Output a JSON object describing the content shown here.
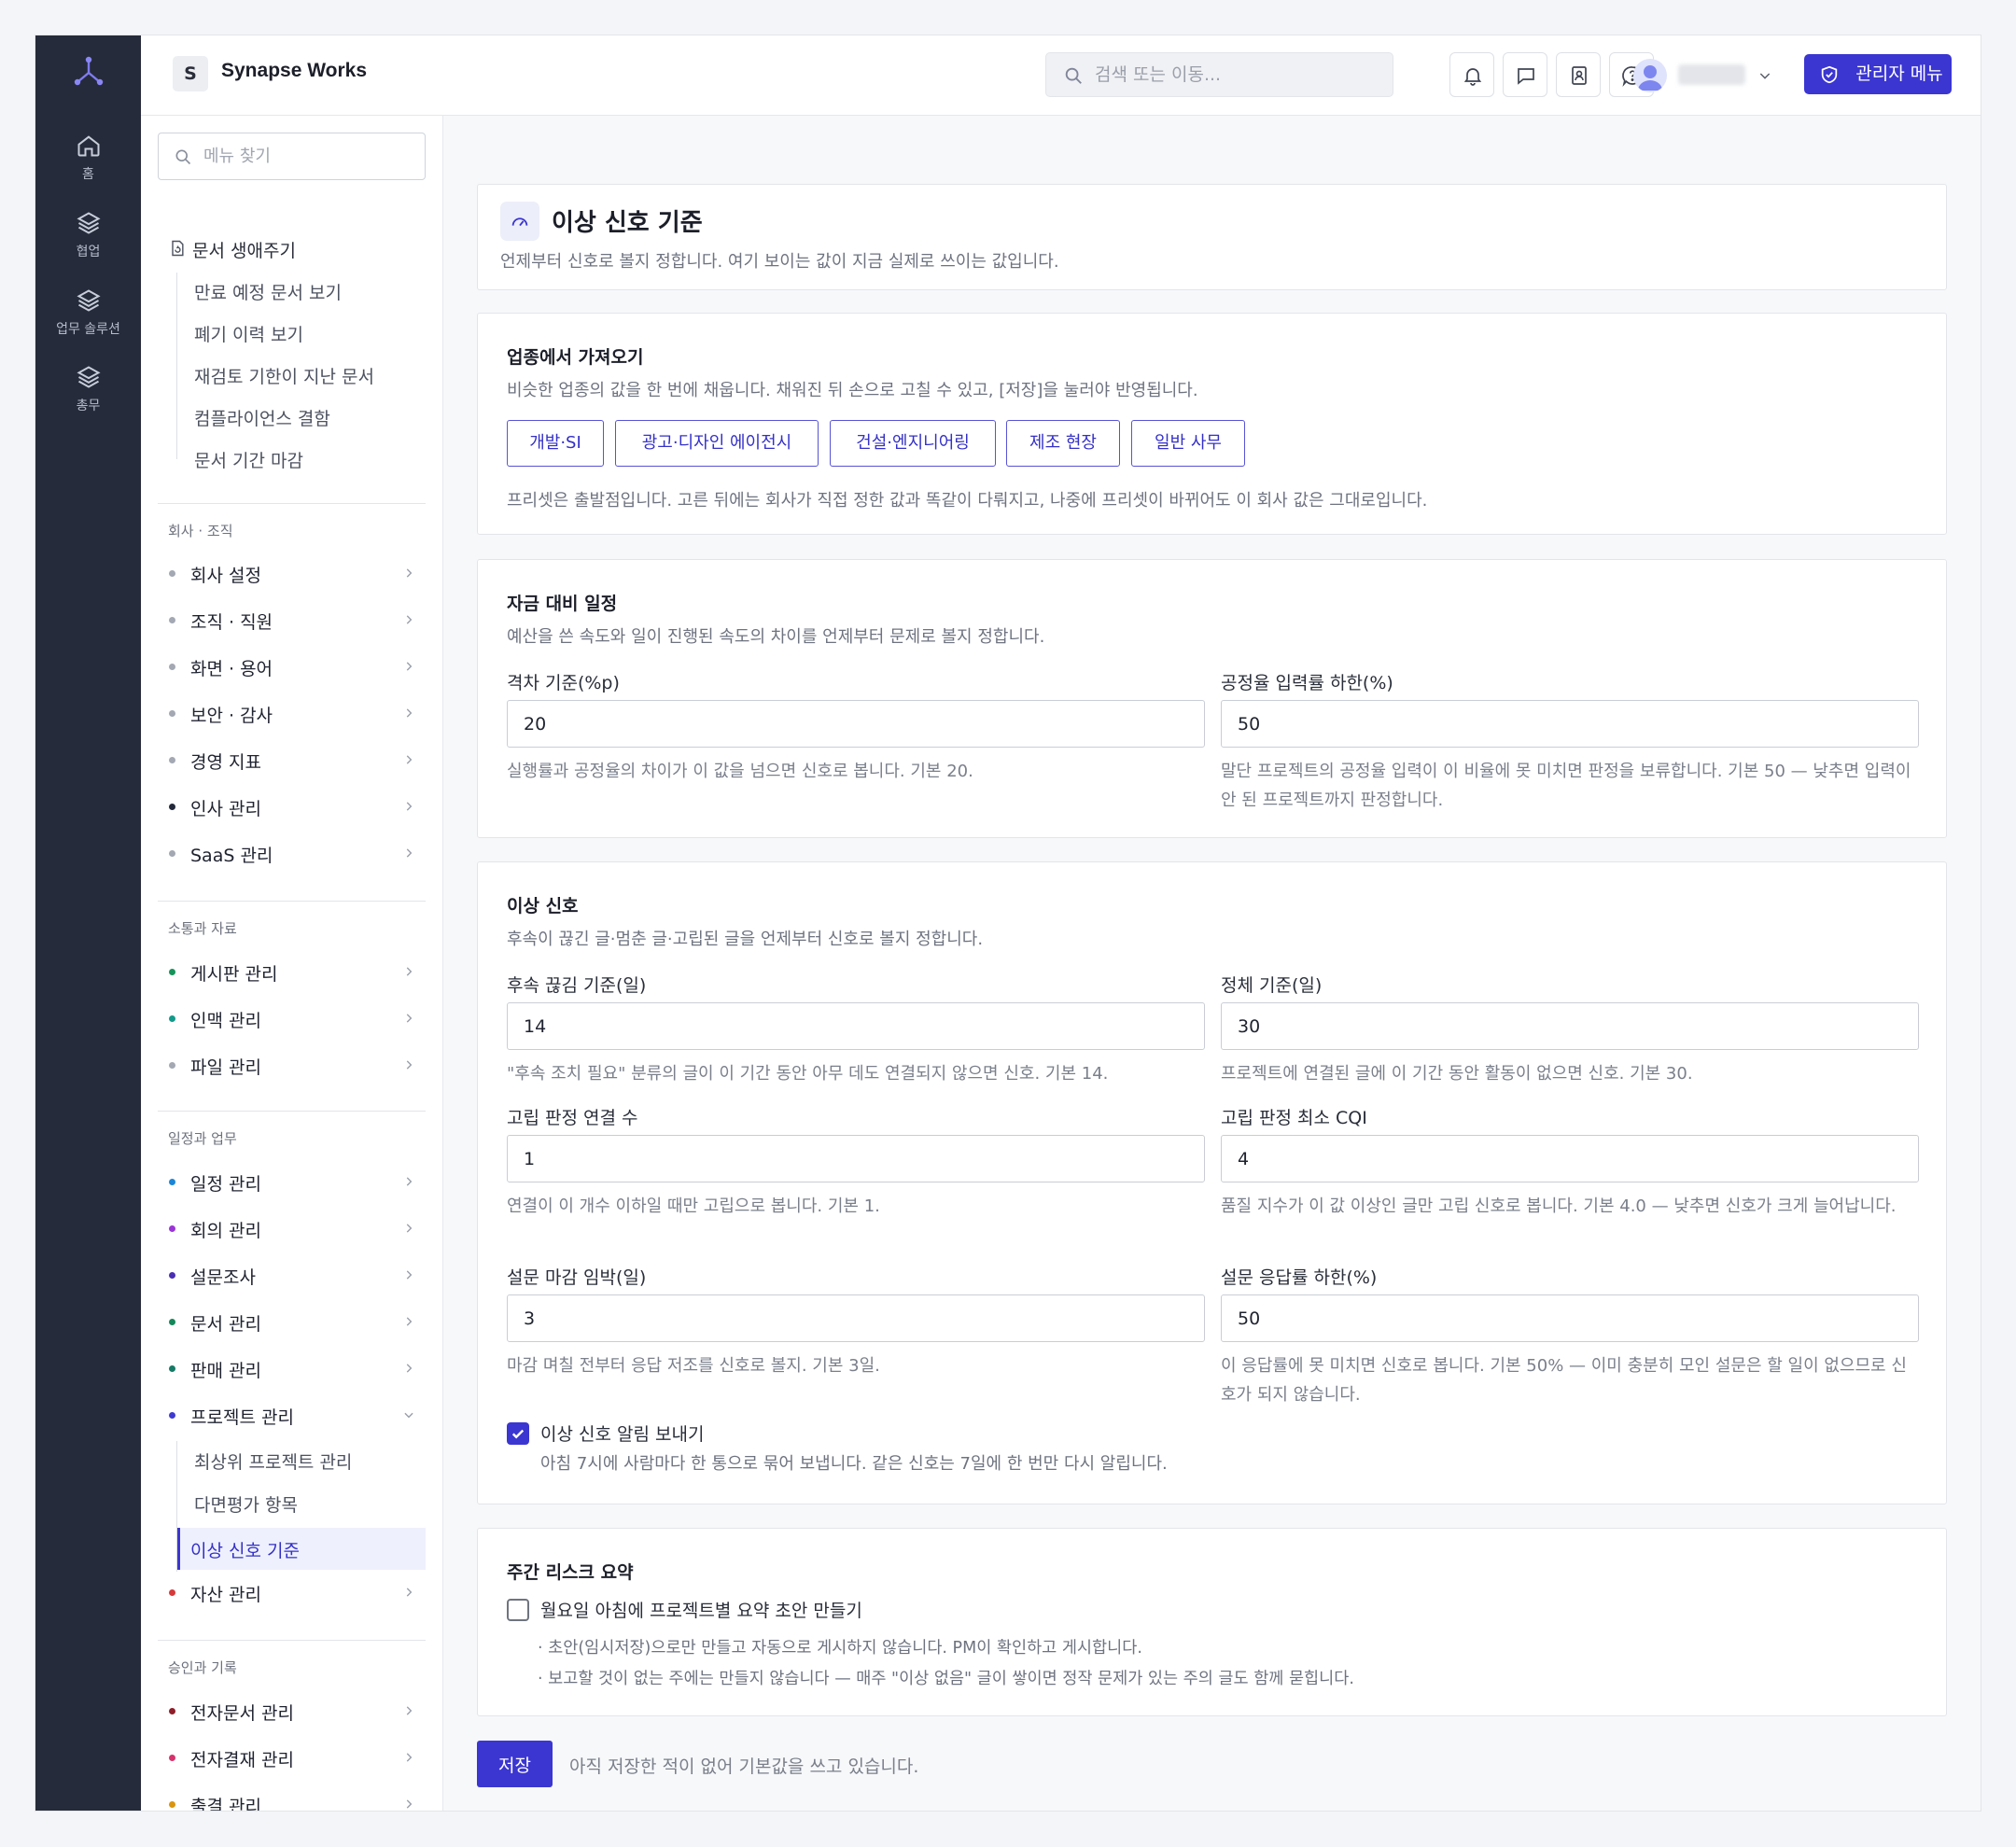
{
  "brand": {
    "accent": "#3b36d1",
    "rail_bg": "#262b3b"
  },
  "rail": {
    "items": [
      {
        "label": "홈",
        "icon": "home-icon"
      },
      {
        "label": "협업",
        "icon": "layers-icon"
      },
      {
        "label": "업무 솔루션",
        "icon": "layers-icon"
      },
      {
        "label": "총무",
        "icon": "layers-icon"
      }
    ]
  },
  "topbar": {
    "workspace_initial": "S",
    "workspace_name": "Synapse Works",
    "search_placeholder": "검색 또는 이동...",
    "icons": [
      "bell-icon",
      "chat-icon",
      "contacts-icon",
      "help-icon"
    ],
    "admin_label": "관리자 메뉴"
  },
  "menu": {
    "search_placeholder": "메뉴 찾기",
    "lifecycle": {
      "label": "문서 생애주기",
      "items": [
        "만료 예정 문서 보기",
        "폐기 이력 보기",
        "재검토 기한이 지난 문서",
        "컴플라이언스 결함",
        "문서 기간 마감"
      ]
    },
    "sections": [
      {
        "title": "회사 · 조직",
        "items": [
          "회사 설정",
          "조직 · 직원",
          "화면 · 용어",
          "보안 · 감사",
          "경영 지표",
          "인사 관리",
          "SaaS 관리"
        ]
      },
      {
        "title": "소통과 자료",
        "items": [
          "게시판 관리",
          "인맥 관리",
          "파일 관리"
        ]
      },
      {
        "title": "일정과 업무",
        "items": [
          "일정 관리",
          "회의 관리",
          "설문조사",
          "문서 관리",
          "판매 관리",
          "프로젝트 관리"
        ]
      },
      {
        "title": "승인과 기록",
        "items": [
          "전자문서 관리",
          "전자결재 관리",
          "출결 관리"
        ]
      }
    ],
    "project_sub": [
      "최상위 프로젝트 관리",
      "다면평가 항목",
      "이상 신호 기준"
    ],
    "asset": "자산 관리"
  },
  "page": {
    "title": "이상 신호 기준",
    "description": "언제부터 신호로 볼지 정합니다. 여기 보이는 값이 지금 실제로 쓰이는 값입니다."
  },
  "preset_card": {
    "title": "업종에서 가져오기",
    "description": "비슷한 업종의 값을 한 번에 채웁니다. 채워진 뒤 손으로 고칠 수 있고, [저장]을 눌러야 반영됩니다.",
    "buttons": [
      "개발·SI",
      "광고·디자인 에이전시",
      "건설·엔지니어링",
      "제조 현장",
      "일반 사무"
    ],
    "note": "프리셋은 출발점입니다. 고른 뒤에는 회사가 직접 정한 값과 똑같이 다뤄지고, 나중에 프리셋이 바뀌어도 이 회사 값은 그대로입니다."
  },
  "budget_card": {
    "title": "자금 대비 일정",
    "description": "예산을 쓴 속도와 일이 진행된 속도의 차이를 언제부터 문제로 볼지 정합니다.",
    "fields": [
      {
        "label": "격차 기준(%p)",
        "value": "20",
        "hint": "실행률과 공정율의 차이가 이 값을 넘으면 신호로 봅니다. 기본 20."
      },
      {
        "label": "공정율 입력률 하한(%)",
        "value": "50",
        "hint": "말단 프로젝트의 공정율 입력이 이 비율에 못 미치면 판정을 보류합니다. 기본 50 — 낮추면 입력이 안 된 프로젝트까지 판정합니다."
      }
    ]
  },
  "anomaly_card": {
    "title": "이상 신호",
    "description": "후속이 끊긴 글·멈춘 글·고립된 글을 언제부터 신호로 볼지 정합니다.",
    "fields": [
      {
        "label": "후속 끊김 기준(일)",
        "value": "14",
        "hint": "\"후속 조치 필요\" 분류의 글이 이 기간 동안 아무 데도 연결되지 않으면 신호. 기본 14."
      },
      {
        "label": "정체 기준(일)",
        "value": "30",
        "hint": "프로젝트에 연결된 글에 이 기간 동안 활동이 없으면 신호. 기본 30."
      },
      {
        "label": "고립 판정 연결 수",
        "value": "1",
        "hint": "연결이 이 개수 이하일 때만 고립으로 봅니다. 기본 1."
      },
      {
        "label": "고립 판정 최소 CQI",
        "value": "4",
        "hint": "품질 지수가 이 값 이상인 글만 고립 신호로 봅니다. 기본 4.0 — 낮추면 신호가 크게 늘어납니다."
      },
      {
        "label": "설문 마감 임박(일)",
        "value": "3",
        "hint": "마감 며칠 전부터 응답 저조를 신호로 볼지. 기본 3일."
      },
      {
        "label": "설문 응답률 하한(%)",
        "value": "50",
        "hint": "이 응답률에 못 미치면 신호로 봅니다. 기본 50% — 이미 충분히 모인 설문은 할 일이 없으므로 신호가 되지 않습니다."
      }
    ],
    "notify_label": "이상 신호 알림 보내기",
    "notify_checked": true,
    "notify_hint": "아침 7시에 사람마다 한 통으로 묶어 보냅니다. 같은 신호는 7일에 한 번만 다시 알립니다."
  },
  "weekly_card": {
    "title": "주간 리스크 요약",
    "checkbox_label": "월요일 아침에 프로젝트별 요약 초안 만들기",
    "checked": false,
    "notes": [
      "· 초안(임시저장)으로만 만들고 자동으로 게시하지 않습니다. PM이 확인하고 게시합니다.",
      "· 보고할 것이 없는 주에는 만들지 않습니다 — 매주 \"이상 없음\" 글이 쌓이면 정작 문제가 있는 주의 글도 함께 묻힙니다."
    ]
  },
  "footer": {
    "save_label": "저장",
    "save_note": "아직 저장한 적이 없어 기본값을 쓰고 있습니다."
  }
}
